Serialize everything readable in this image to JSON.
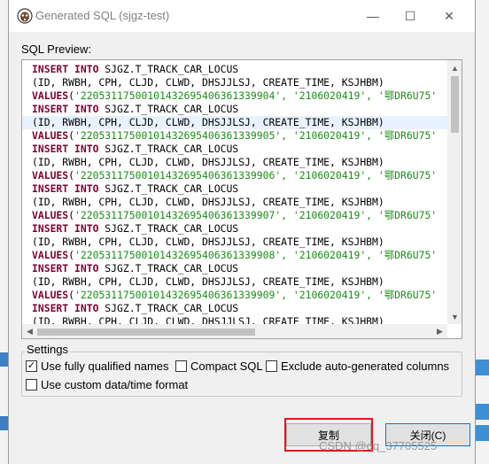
{
  "window": {
    "title": "Generated SQL (sjgz-test)",
    "minimize": "—",
    "maximize": "☐",
    "close": "✕"
  },
  "preview": {
    "label": "SQL Preview:",
    "lines": [
      {
        "type": "insert",
        "kw": "INSERT INTO",
        "rest": " SJGZ.T_TRACK_CAR_LOCUS",
        "highlight": false
      },
      {
        "type": "plain",
        "text": "(ID, RWBH, CPH, CLJD, CLWD, DHSJJLSJ, CREATE_TIME, KSJHBM)",
        "highlight": false
      },
      {
        "type": "values",
        "kw": "VALUES",
        "rest": "('2205311750010143269540636133990​4', '2106020419', '",
        "tail": "鄂DR6U75'",
        "highlight": false
      },
      {
        "type": "insert",
        "kw": "INSERT INTO",
        "rest": " SJGZ.T_TRACK_CAR_LOCUS",
        "highlight": false
      },
      {
        "type": "plain",
        "text": "(ID, RWBH, CPH, CLJD, CLWD, DHSJJLSJ, CREATE_TIME, KSJHBM)",
        "highlight": true
      },
      {
        "type": "values",
        "kw": "VALUES",
        "rest": "('22053117500101432695406361339905', '2106020419', '",
        "tail": "鄂DR6U75'",
        "highlight": false
      },
      {
        "type": "insert",
        "kw": "INSERT INTO",
        "rest": " SJGZ.T_TRACK_CAR_LOCUS",
        "highlight": false
      },
      {
        "type": "plain",
        "text": "(ID, RWBH, CPH, CLJD, CLWD, DHSJJLSJ, CREATE_TIME, KSJHBM)",
        "highlight": false
      },
      {
        "type": "values",
        "kw": "VALUES",
        "rest": "('22053117500101432695406361339906', '2106020419', '",
        "tail": "鄂DR6U75'",
        "highlight": false
      },
      {
        "type": "insert",
        "kw": "INSERT INTO",
        "rest": " SJGZ.T_TRACK_CAR_LOCUS",
        "highlight": false
      },
      {
        "type": "plain",
        "text": "(ID, RWBH, CPH, CLJD, CLWD, DHSJJLSJ, CREATE_TIME, KSJHBM)",
        "highlight": false
      },
      {
        "type": "values",
        "kw": "VALUES",
        "rest": "('22053117500101432695406361339907', '2106020419', '",
        "tail": "鄂DR6U75'",
        "highlight": false
      },
      {
        "type": "insert",
        "kw": "INSERT INTO",
        "rest": " SJGZ.T_TRACK_CAR_LOCUS",
        "highlight": false
      },
      {
        "type": "plain",
        "text": "(ID, RWBH, CPH, CLJD, CLWD, DHSJJLSJ, CREATE_TIME, KSJHBM)",
        "highlight": false
      },
      {
        "type": "values",
        "kw": "VALUES",
        "rest": "('22053117500101432695406361339908', '2106020419', '",
        "tail": "鄂DR6U75'",
        "highlight": false
      },
      {
        "type": "insert",
        "kw": "INSERT INTO",
        "rest": " SJGZ.T_TRACK_CAR_LOCUS",
        "highlight": false
      },
      {
        "type": "plain",
        "text": "(ID, RWBH, CPH, CLJD, CLWD, DHSJJLSJ, CREATE_TIME, KSJHBM)",
        "highlight": false
      },
      {
        "type": "values",
        "kw": "VALUES",
        "rest": "('22053117500101432695406361339909', '2106020419', '",
        "tail": "鄂DR6U75'",
        "highlight": false
      },
      {
        "type": "insert",
        "kw": "INSERT INTO",
        "rest": " SJGZ.T_TRACK_CAR_LOCUS",
        "highlight": false
      },
      {
        "type": "plain",
        "text": "(ID, RWBH, CPH, CLJD, CLWD, DHSJJLSJ, CREATE_TIME, KSJHBM)",
        "highlight": false
      }
    ]
  },
  "settings": {
    "label": "Settings",
    "options": [
      {
        "label": "Use fully qualified names",
        "checked": true
      },
      {
        "label": "Compact SQL",
        "checked": false
      },
      {
        "label": "Exclude auto-generated columns",
        "checked": false
      },
      {
        "label": "Use custom data/time format",
        "checked": false
      }
    ]
  },
  "buttons": {
    "copy": "复制",
    "close": "关闭(C)"
  },
  "watermark": "CSDN @qq_37705525",
  "colors": {
    "keyword": "#7f0033",
    "string": "#1a8c1a",
    "highlight_row": "#e8f2fe",
    "red_annotation": "#e8141e"
  }
}
